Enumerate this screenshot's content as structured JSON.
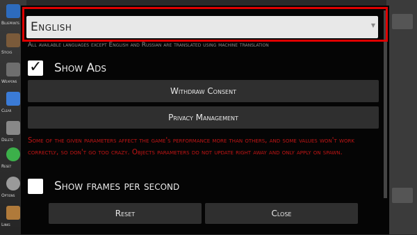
{
  "sidebar": {
    "items": [
      {
        "label": "Blueprints",
        "icon": "blueprint-icon",
        "color": "#2d6bbd"
      },
      {
        "label": "Sticks",
        "icon": "sticks-icon",
        "color": "#7a5a3a"
      },
      {
        "label": "Weapons",
        "icon": "weapon-icon",
        "color": "#6e6e6e"
      },
      {
        "label": "Clear",
        "icon": "broom-icon",
        "color": "#3b7bd6"
      },
      {
        "label": "Delete",
        "icon": "delete-icon",
        "color": "#888888"
      },
      {
        "label": "Reset",
        "icon": "reset-icon",
        "color": "#3cb04a"
      },
      {
        "label": "Options",
        "icon": "gear-icon",
        "color": "#9a9a9a"
      },
      {
        "label": "Links",
        "icon": "box-icon",
        "color": "#b07a3a"
      }
    ]
  },
  "settings": {
    "language": {
      "selected": "English",
      "note": "All available languages except English and Russian are translated using machine translation"
    },
    "show_ads": {
      "label": "Show Ads",
      "checked": true
    },
    "withdraw_consent_label": "Withdraw Consent",
    "privacy_management_label": "Privacy Management",
    "warning_text": "Some of the given parameters affect the game's performance more than others, and some values won't work correctly, so don't go too crazy. Objects parameters do not update right away and only apply on spawn.",
    "show_fps": {
      "label": "Show frames per second",
      "checked": false
    }
  },
  "footer": {
    "reset_label": "Reset",
    "close_label": "Close"
  },
  "colors": {
    "highlight": "#e00000",
    "warning": "#c21515",
    "dialog_bg": "#050505",
    "button_bg": "#2f2f2f"
  }
}
